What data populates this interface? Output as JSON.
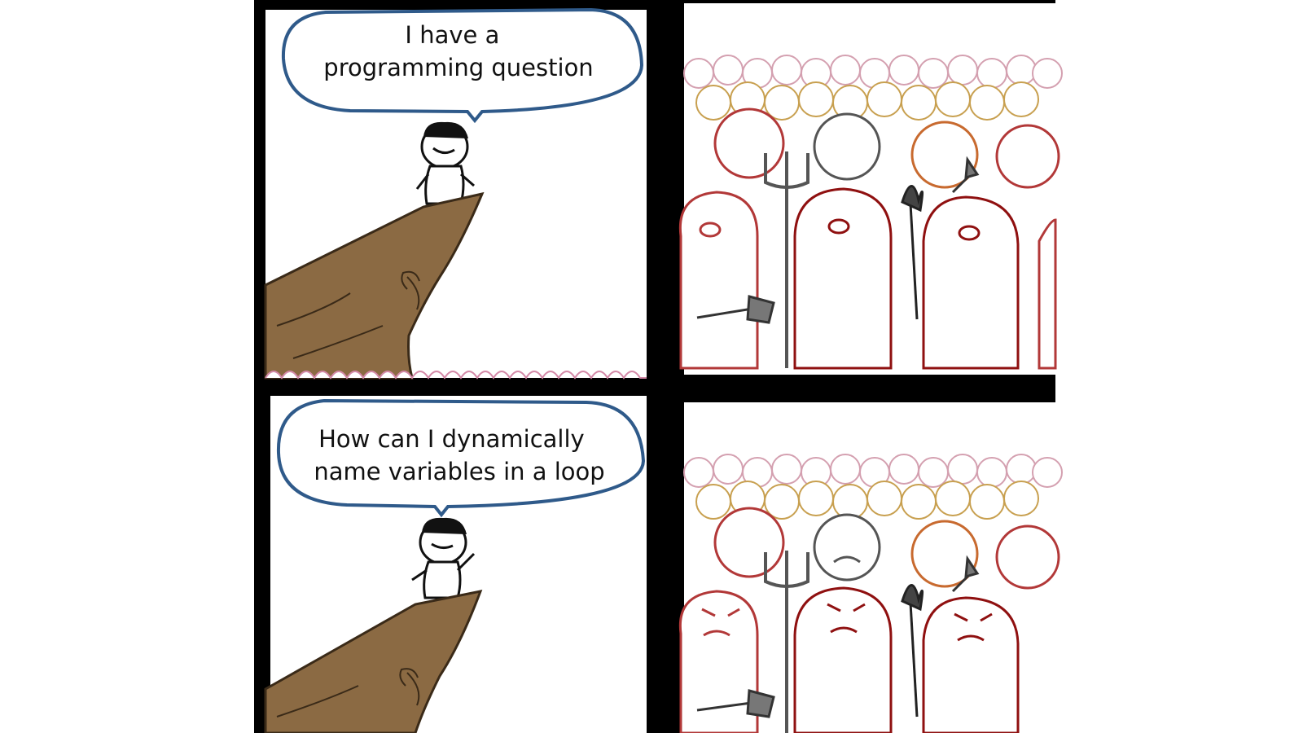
{
  "comic": {
    "panel1": {
      "speech": [
        "I have a",
        "programming question"
      ]
    },
    "panel3": {
      "speech": [
        "How can I dynamically",
        "name variables in a loop"
      ]
    }
  },
  "colors": {
    "border": "#000000",
    "bubble_outline": "#2f5a8a",
    "cliff_fill": "#8b6a43",
    "cliff_outline": "#3a2a18",
    "crowd_outlines": [
      "#8f1010",
      "#b23838",
      "#c86a2f",
      "#c8a050",
      "#d48aa8",
      "#c0a0a0"
    ]
  },
  "icons": [
    "trident-icon",
    "torch-icon",
    "axe-icon",
    "spear-icon"
  ]
}
